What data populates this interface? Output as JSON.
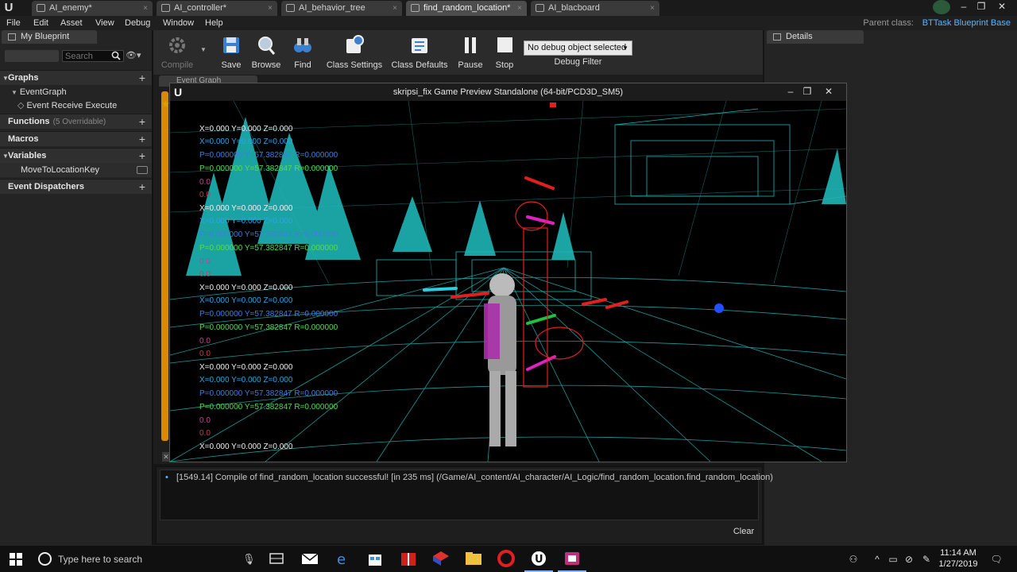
{
  "tabs": [
    {
      "label": "AI_enemy*"
    },
    {
      "label": "AI_controller*"
    },
    {
      "label": "AI_behavior_tree"
    },
    {
      "label": "find_random_location*"
    },
    {
      "label": "AI_blacboard"
    }
  ],
  "menu": [
    "File",
    "Edit",
    "Asset",
    "View",
    "Debug",
    "Window",
    "Help"
  ],
  "parent_class": {
    "label": "Parent class:",
    "value": "BTTask Blueprint Base"
  },
  "my_blueprint": {
    "tab_label": "My Blueprint",
    "search_placeholder": "Search",
    "graphs_label": "Graphs",
    "event_graph": "EventGraph",
    "event_receive_execute": "Event Receive Execute",
    "functions_label": "Functions",
    "functions_sub": "(5 Overridable)",
    "macros_label": "Macros",
    "variables_label": "Variables",
    "variable_name": "MoveToLocationKey",
    "dispatchers_label": "Event Dispatchers"
  },
  "toolbar": {
    "compile": "Compile",
    "save": "Save",
    "browse": "Browse",
    "find": "Find",
    "class_settings": "Class Settings",
    "class_defaults": "Class Defaults",
    "pause": "Pause",
    "stop": "Stop",
    "debug_select": "No debug object selected",
    "debug_filter": "Debug Filter"
  },
  "graph_tab": "Event Graph",
  "details": {
    "tab_label": "Details"
  },
  "game_window": {
    "title": "skripsi_fix Game Preview Standalone (64-bit/PCD3D_SM5)",
    "debug_groups": [
      {
        "xyz": "X=0.000 Y=0.000 Z=0.000",
        "xyz2": "X=0.000 Y=0.000 Z=0.000",
        "pyr1": "P=0.000000 Y=57.382847 R=0.000000",
        "pyr2": "P=0.000000 Y=57.382847 R=0.000000",
        "v1": "0.0",
        "v2": "0.0"
      },
      {
        "xyz": "X=0.000 Y=0.000 Z=0.000",
        "xyz2": "X=0.000 Y=0.000 Z=0.000",
        "pyr1": "P=0.000000 Y=57.382847 R=0.000000",
        "pyr2": "P=0.000000 Y=57.382847 R=0.000000",
        "v1": "0.0",
        "v2": "0.0"
      },
      {
        "xyz": "X=0.000 Y=0.000 Z=0.000",
        "xyz2": "X=0.000 Y=0.000 Z=0.000",
        "pyr1": "P=0.000000 Y=57.382847 R=0.000000",
        "pyr2": "P=0.000000 Y=57.382847 R=0.000000",
        "v1": "0.0",
        "v2": "0.0"
      },
      {
        "xyz": "X=0.000 Y=0.000 Z=0.000",
        "xyz2": "X=0.000 Y=0.000 Z=0.000",
        "pyr1": "P=0.000000 Y=57.382847 R=0.000000",
        "pyr2": "P=0.000000 Y=57.382847 R=0.000000",
        "v1": "0.0",
        "v2": "0.0"
      }
    ],
    "last_xyz": "X=0.000 Y=0.000 Z=0.000"
  },
  "log": {
    "message": "[1549.14] Compile of find_random_location successful! [in 235 ms] (/Game/AI_content/AI_character/AI_Logic/find_random_location.find_random_location)",
    "clear": "Clear"
  },
  "taskbar": {
    "search_placeholder": "Type here to search",
    "time": "11:14 AM",
    "date": "1/27/2019"
  },
  "colors": {
    "wire_cyan": "#1fb5b5",
    "accent_blue": "#5bb4ff",
    "debug_white": "#f0f0f0",
    "debug_blue": "#3b7fe0",
    "debug_green": "#58d858",
    "debug_magenta": "#e0309a"
  }
}
